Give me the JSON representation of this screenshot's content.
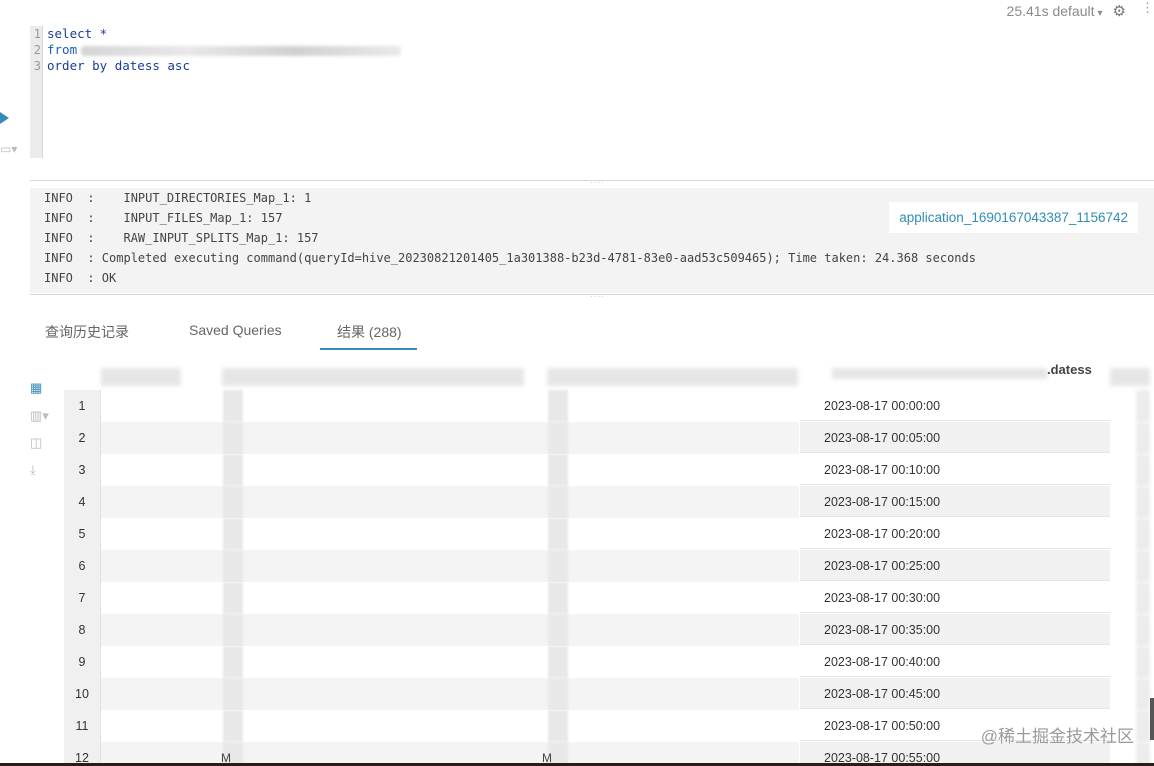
{
  "top": {
    "timing": "25.41s default",
    "caret": "▾",
    "gear": "⚙",
    "more": "⋮"
  },
  "editor": {
    "line_numbers": [
      "1",
      "2",
      "3"
    ],
    "line1": "select *",
    "line2_kw": "from",
    "line3": "order by datess asc"
  },
  "log": {
    "lines": [
      "INFO  :    INPUT_DIRECTORIES_Map_1: 1",
      "INFO  :    INPUT_FILES_Map_1: 157",
      "INFO  :    RAW_INPUT_SPLITS_Map_1: 157",
      "INFO  : Completed executing command(queryId=hive_20230821201405_1a301388-b23d-4781-83e0-aad53c509465); Time taken: 24.368 seconds",
      "INFO  : OK"
    ],
    "app_link": "application_1690167043387_1156742"
  },
  "tabs": [
    {
      "label": "查询历史记录"
    },
    {
      "label": "Saved Queries"
    },
    {
      "label": "结果 (288)"
    }
  ],
  "results": {
    "column_title": ".datess",
    "rows": [
      {
        "n": "1",
        "date": "2023-08-17 00:00:00"
      },
      {
        "n": "2",
        "date": "2023-08-17 00:05:00"
      },
      {
        "n": "3",
        "date": "2023-08-17 00:10:00"
      },
      {
        "n": "4",
        "date": "2023-08-17 00:15:00"
      },
      {
        "n": "5",
        "date": "2023-08-17 00:20:00"
      },
      {
        "n": "6",
        "date": "2023-08-17 00:25:00"
      },
      {
        "n": "7",
        "date": "2023-08-17 00:30:00"
      },
      {
        "n": "8",
        "date": "2023-08-17 00:35:00"
      },
      {
        "n": "9",
        "date": "2023-08-17 00:40:00"
      },
      {
        "n": "10",
        "date": "2023-08-17 00:45:00"
      },
      {
        "n": "11",
        "date": "2023-08-17 00:50:00"
      },
      {
        "n": "12",
        "date": "2023-08-17 00:55:00"
      }
    ],
    "m_label": "M"
  },
  "watermark": "@稀土掘金技术社区",
  "colors": {
    "accent": "#338bb8"
  }
}
